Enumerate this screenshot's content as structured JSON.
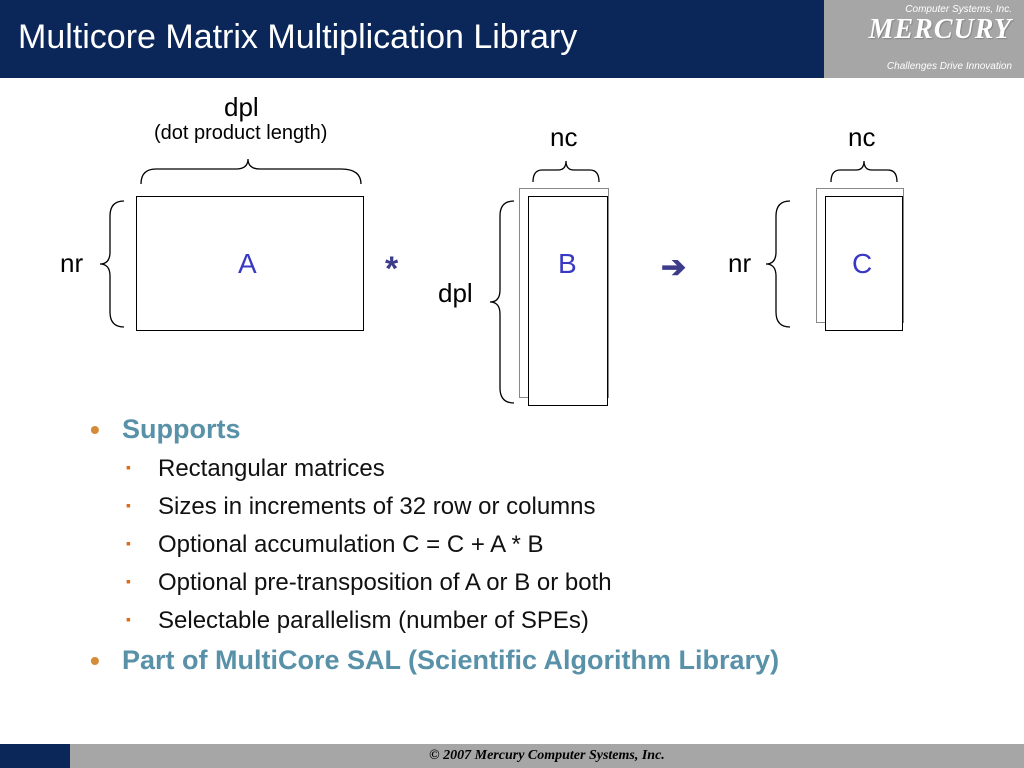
{
  "header": {
    "title": "Multicore Matrix Multiplication Library",
    "logo": {
      "top": "Computer Systems, Inc.",
      "main": "MERCURY",
      "tagline": "Challenges Drive Innovation"
    }
  },
  "diagram": {
    "dpl_label": "dpl",
    "dpl_sub": "(dot product length)",
    "nr_label": "nr",
    "nc_label": "nc",
    "A": "A",
    "B": "B",
    "C": "C",
    "times": "*",
    "arrow": "➔",
    "dpl_left": "dpl"
  },
  "bullets": {
    "supports": "Supports",
    "items": [
      "Rectangular matrices",
      "Sizes in increments of 32 row or columns",
      "Optional accumulation C = C + A * B",
      "Optional pre-transposition of A or B or both",
      "Selectable parallelism (number of SPEs)"
    ],
    "part_of": "Part of MultiCore SAL (Scientific Algorithm Library)"
  },
  "footer": "© 2007 Mercury Computer Systems, Inc."
}
